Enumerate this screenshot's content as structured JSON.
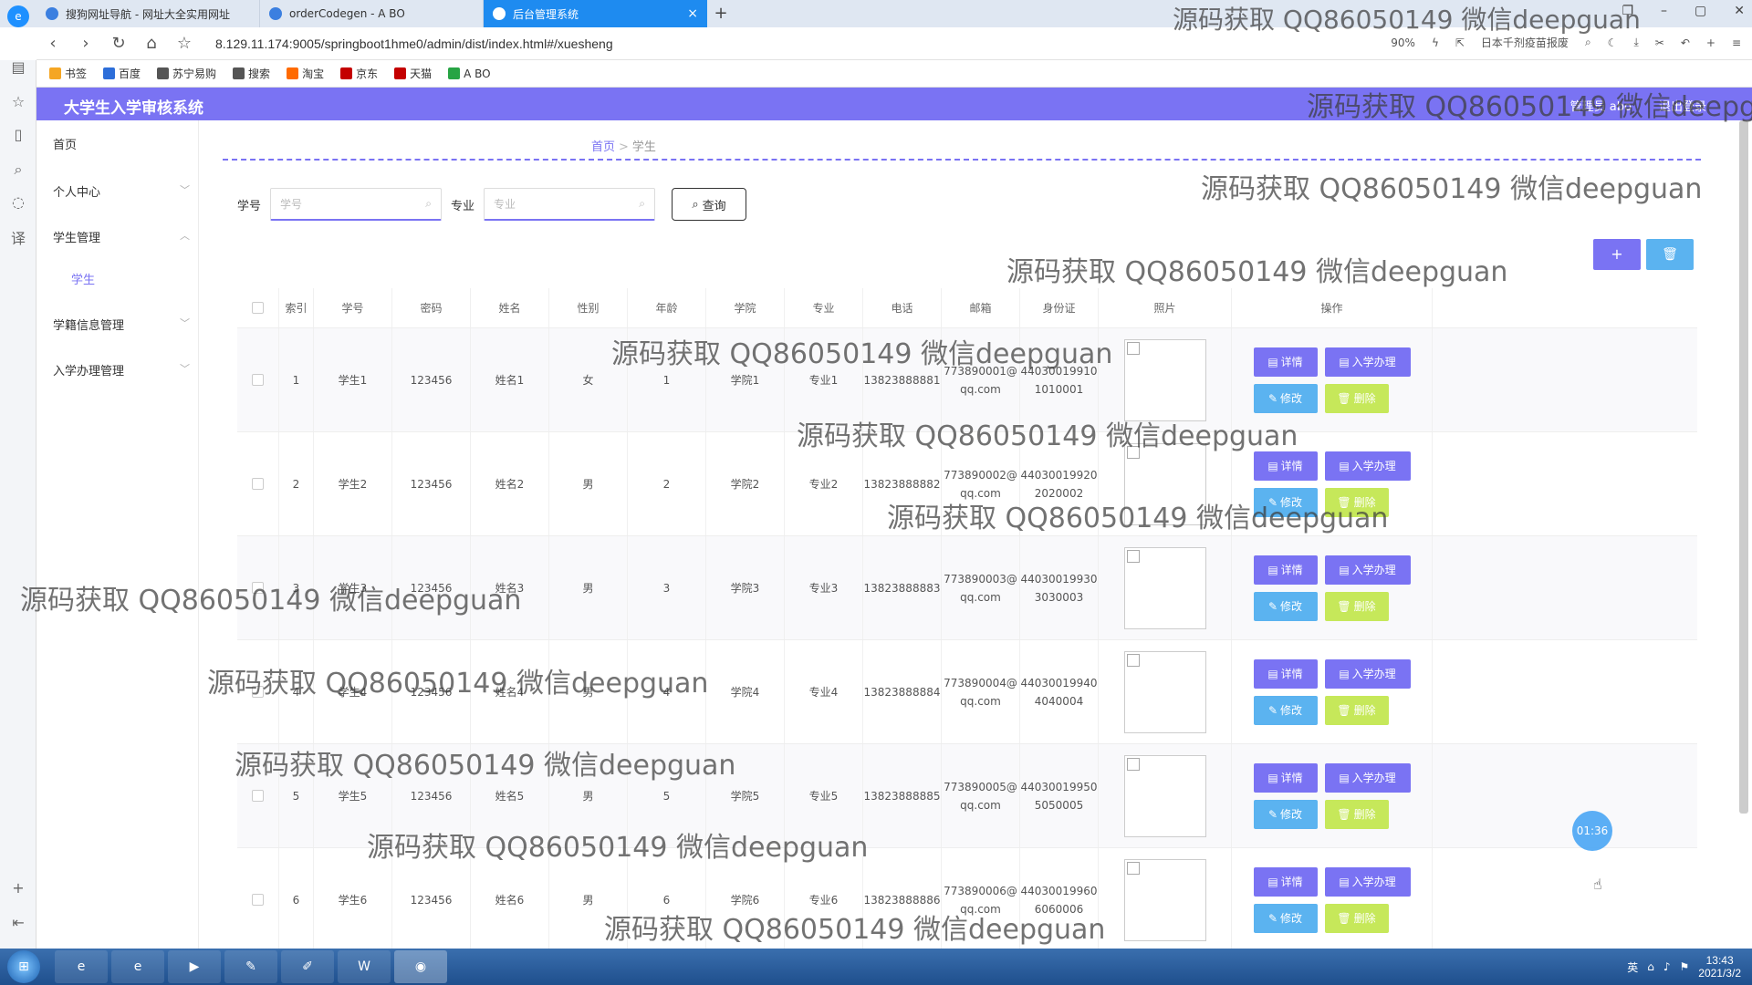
{
  "browser": {
    "tabs": [
      {
        "title": "搜狗网址导航 - 网址大全实用网址",
        "icon": "sogou-icon"
      },
      {
        "title": "orderCodegen - A BO",
        "icon": "page-icon"
      },
      {
        "title": "后台管理系统",
        "icon": "vue-icon"
      }
    ],
    "url": "8.129.11.174:9005/springboot1hme0/admin/dist/index.html#/xuesheng",
    "zoom": "90%",
    "search_hint": "日本千剂疫苗报废",
    "bookmarks": [
      "书签",
      "百度",
      "苏宁易购",
      "搜索",
      "淘宝",
      "京东",
      "天猫",
      "A BO"
    ]
  },
  "app": {
    "title": "大学生入学审核系统",
    "header_right": [
      "管理员 abo",
      "退出登录"
    ],
    "accent": "#7a73f3"
  },
  "sidebar": {
    "items": [
      "首页",
      "个人中心",
      "学生管理",
      "学籍信息管理",
      "入学办理管理"
    ],
    "sub_item": "学生"
  },
  "breadcrumb": {
    "home": "首页",
    "current": "学生"
  },
  "search": {
    "label1": "学号",
    "placeholder1": "学号",
    "label2": "专业",
    "placeholder2": "专业",
    "button": "查询"
  },
  "table": {
    "headers": [
      "索引",
      "学号",
      "密码",
      "姓名",
      "性别",
      "年龄",
      "学院",
      "专业",
      "电话",
      "邮箱",
      "身份证",
      "照片",
      "操作"
    ],
    "rows": [
      [
        "1",
        "学生1",
        "123456",
        "姓名1",
        "女",
        "1",
        "学院1",
        "专业1",
        "13823888881",
        "773890001@\nqq.com",
        "44030019910\n1010001"
      ],
      [
        "2",
        "学生2",
        "123456",
        "姓名2",
        "男",
        "2",
        "学院2",
        "专业2",
        "13823888882",
        "773890002@\nqq.com",
        "44030019920\n2020002"
      ],
      [
        "3",
        "学生3",
        "123456",
        "姓名3",
        "男",
        "3",
        "学院3",
        "专业3",
        "13823888883",
        "773890003@\nqq.com",
        "44030019930\n3030003"
      ],
      [
        "4",
        "学生4",
        "123456",
        "姓名4",
        "男",
        "4",
        "学院4",
        "专业4",
        "13823888884",
        "773890004@\nqq.com",
        "44030019940\n4040004"
      ],
      [
        "5",
        "学生5",
        "123456",
        "姓名5",
        "男",
        "5",
        "学院5",
        "专业5",
        "13823888885",
        "773890005@\nqq.com",
        "44030019950\n5050005"
      ],
      [
        "6",
        "学生6",
        "123456",
        "姓名6",
        "男",
        "6",
        "学院6",
        "专业6",
        "13823888886",
        "773890006@\nqq.com",
        "44030019960\n6060006"
      ]
    ],
    "ops": {
      "detail": "详情",
      "enroll": "入学办理",
      "edit": "修改",
      "delete": "删除"
    }
  },
  "timer": "01:36",
  "watermark": "源码获取 QQ86050149 微信deepguan",
  "taskbar": {
    "time": "13:43",
    "date": "2021/3/2",
    "ime": "英"
  }
}
